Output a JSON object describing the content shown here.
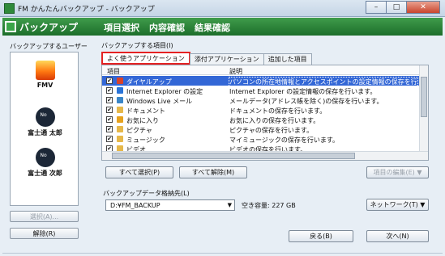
{
  "window": {
    "title": "FM かんたんバックアップ - バックアップ",
    "buttons": [
      "–",
      "□",
      "✕"
    ]
  },
  "header": {
    "brand": "バックアップ",
    "steps": [
      "項目選択",
      "内容確認",
      "結果確認"
    ]
  },
  "left": {
    "label": "バックアップするユーザー(U)",
    "users": [
      {
        "name": "FMV",
        "icon": "flame-avatar-icon"
      },
      {
        "name": "富士通 太郎",
        "icon": "user-avatar-icon"
      },
      {
        "name": "富士通 次郎",
        "icon": "user-avatar-icon"
      }
    ],
    "select_button": "選択(A)...",
    "remove_button": "解除(R)"
  },
  "right": {
    "label": "バックアップする項目(I)",
    "tabs": [
      "よく使うアプリケーション",
      "添付アプリケーション",
      "追加した項目"
    ],
    "columns": [
      "項目",
      "説明"
    ],
    "rows": [
      {
        "name": "ダイヤルアップ",
        "desc": "パソコンの所在地情報とアクセスポイントの設定情報の保存を行います。",
        "checked": true,
        "selected": true,
        "icon": "dialup-icon",
        "color": "#d8432a"
      },
      {
        "name": "Internet Explorer の設定",
        "desc": "Internet Explorer の設定情報の保存を行います。",
        "checked": true,
        "selected": false,
        "icon": "ie-icon",
        "color": "#2a74d8"
      },
      {
        "name": "Windows Live メール",
        "desc": "メールデータ(アドレス帳を除く)の保存を行います。",
        "checked": true,
        "selected": false,
        "icon": "mail-icon",
        "color": "#3a86c8"
      },
      {
        "name": "ドキュメント",
        "desc": "ドキュメントの保存を行います。",
        "checked": true,
        "selected": false,
        "icon": "document-folder-icon",
        "color": "#e6b84a"
      },
      {
        "name": "お気に入り",
        "desc": "お気に入りの保存を行います。",
        "checked": true,
        "selected": false,
        "icon": "favorites-star-icon",
        "color": "#e6a21e"
      },
      {
        "name": "ピクチャ",
        "desc": "ピクチャの保存を行います。",
        "checked": true,
        "selected": false,
        "icon": "pictures-folder-icon",
        "color": "#e6b84a"
      },
      {
        "name": "ミュージック",
        "desc": "マイミュージックの保存を行います。",
        "checked": true,
        "selected": false,
        "icon": "music-folder-icon",
        "color": "#e6b84a"
      },
      {
        "name": "ビデオ",
        "desc": "ビデオの保存を行います。",
        "checked": true,
        "selected": false,
        "icon": "video-folder-icon",
        "color": "#e6b84a"
      }
    ],
    "select_all": "すべて選択(P)",
    "deselect_all": "すべて解除(M)",
    "edit_item": "項目の編集(E) ▼"
  },
  "destination": {
    "label": "バックアップデータ格納先(L)",
    "path": "D:¥FM_BACKUP",
    "free_space": "空き容量: 227 GB",
    "network": "ネットワーク(T) ▼"
  },
  "footer": {
    "back": "戻る(B)",
    "next": "次へ(N)"
  },
  "colors": {
    "header_green": "#2e8a3c",
    "selection_blue": "#3367d6",
    "highlight_red": "#e52222"
  }
}
